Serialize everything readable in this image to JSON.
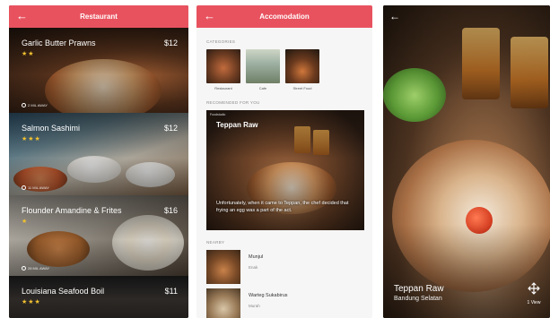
{
  "restaurant_screen": {
    "title": "Restaurant",
    "back_icon": "arrow-left-icon",
    "items": [
      {
        "name": "Garlic Butter Prawns",
        "price": "$12",
        "stars": "★★",
        "distance": "2 MIL AWAY"
      },
      {
        "name": "Salmon Sashimi",
        "price": "$12",
        "stars": "★★★",
        "distance": "11 MIL AWAY"
      },
      {
        "name": "Flounder Amandine & Frites",
        "price": "$16",
        "stars": "★",
        "distance": "28 MIL AWAY"
      },
      {
        "name": "Louisiana Seafood Boil",
        "price": "$11",
        "stars": "★★★",
        "distance": ""
      }
    ]
  },
  "accomodation_screen": {
    "title": "Accomodation",
    "back_icon": "arrow-left-icon",
    "categories_label": "CATEGORIES",
    "categories": [
      {
        "label": "Restaurant"
      },
      {
        "label": "Cafe"
      },
      {
        "label": "Street Food"
      }
    ],
    "recommended_label": "RECOMENDED FOR YOU",
    "featured": {
      "badge": "Foodstudio",
      "title": "Teppan Raw",
      "description": "Unfortunately, when it came to Teppan, the chef decided that frying an egg was a part of the act."
    },
    "nearby_label": "NEARBY",
    "nearby": [
      {
        "name": "Munjul",
        "subtitle": "Enak"
      },
      {
        "name": "Warteg Sukabirus",
        "subtitle": "Murah"
      }
    ]
  },
  "detail_screen": {
    "back_icon": "arrow-left-icon",
    "title": "Teppan Raw",
    "subtitle": "Bandung Selatan",
    "views_label": "1 View",
    "views_icon": "move-arrows-icon"
  },
  "colors": {
    "accent": "#e8525f",
    "star": "#f2c230"
  }
}
